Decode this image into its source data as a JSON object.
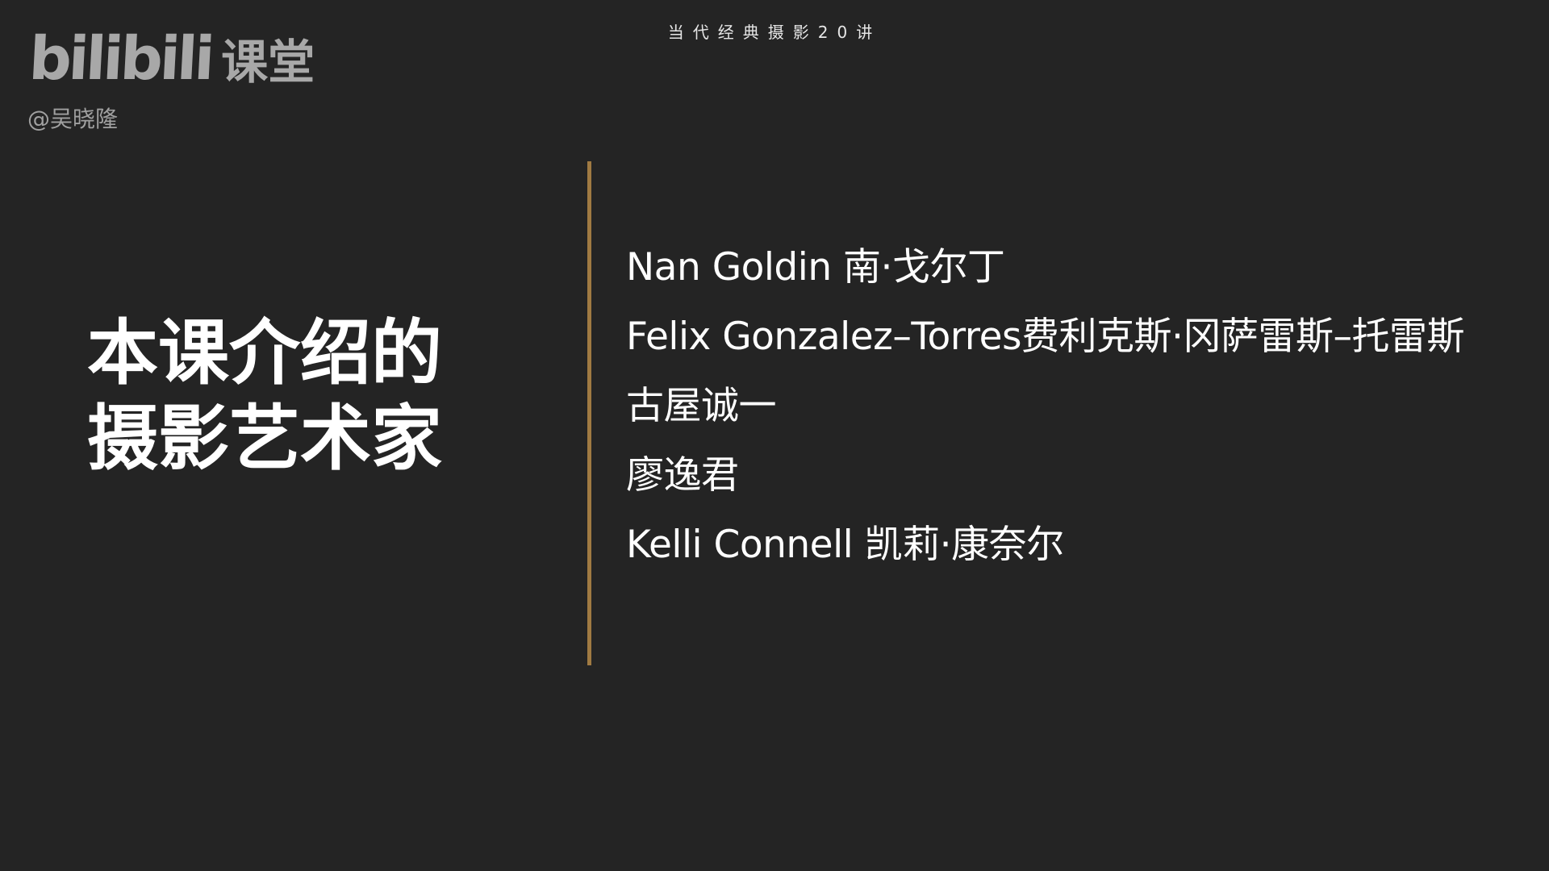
{
  "header": {
    "course_title": "当代经典摄影20讲"
  },
  "branding": {
    "logo_text": "bilibili",
    "logo_suffix": "课堂",
    "author_handle": "@吴晓隆"
  },
  "slide": {
    "heading_line1": "本课介绍的",
    "heading_line2": "摄影艺术家",
    "divider_color": "#a07a42",
    "artists": [
      "Nan Goldin 南·戈尔丁",
      "Felix Gonzalez–Torres费利克斯·冈萨雷斯–托雷斯",
      "古屋诚一",
      "廖逸君",
      "Kelli Connell 凯莉·康奈尔"
    ]
  }
}
